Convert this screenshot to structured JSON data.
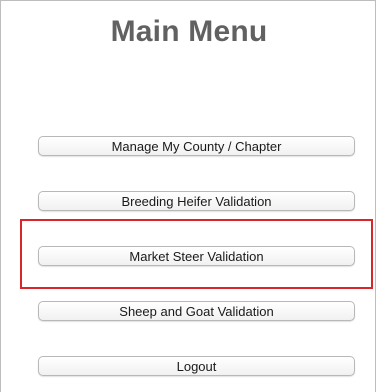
{
  "menu": {
    "title": "Main Menu",
    "buttons": [
      {
        "label": "Manage My County / Chapter"
      },
      {
        "label": "Breeding Heifer Validation"
      },
      {
        "label": "Market Steer Validation"
      },
      {
        "label": "Sheep and Goat Validation"
      },
      {
        "label": "Logout"
      }
    ]
  },
  "colors": {
    "title": "#616161",
    "highlight_border": "#d9262a",
    "button_border": "#b8b8b8"
  }
}
